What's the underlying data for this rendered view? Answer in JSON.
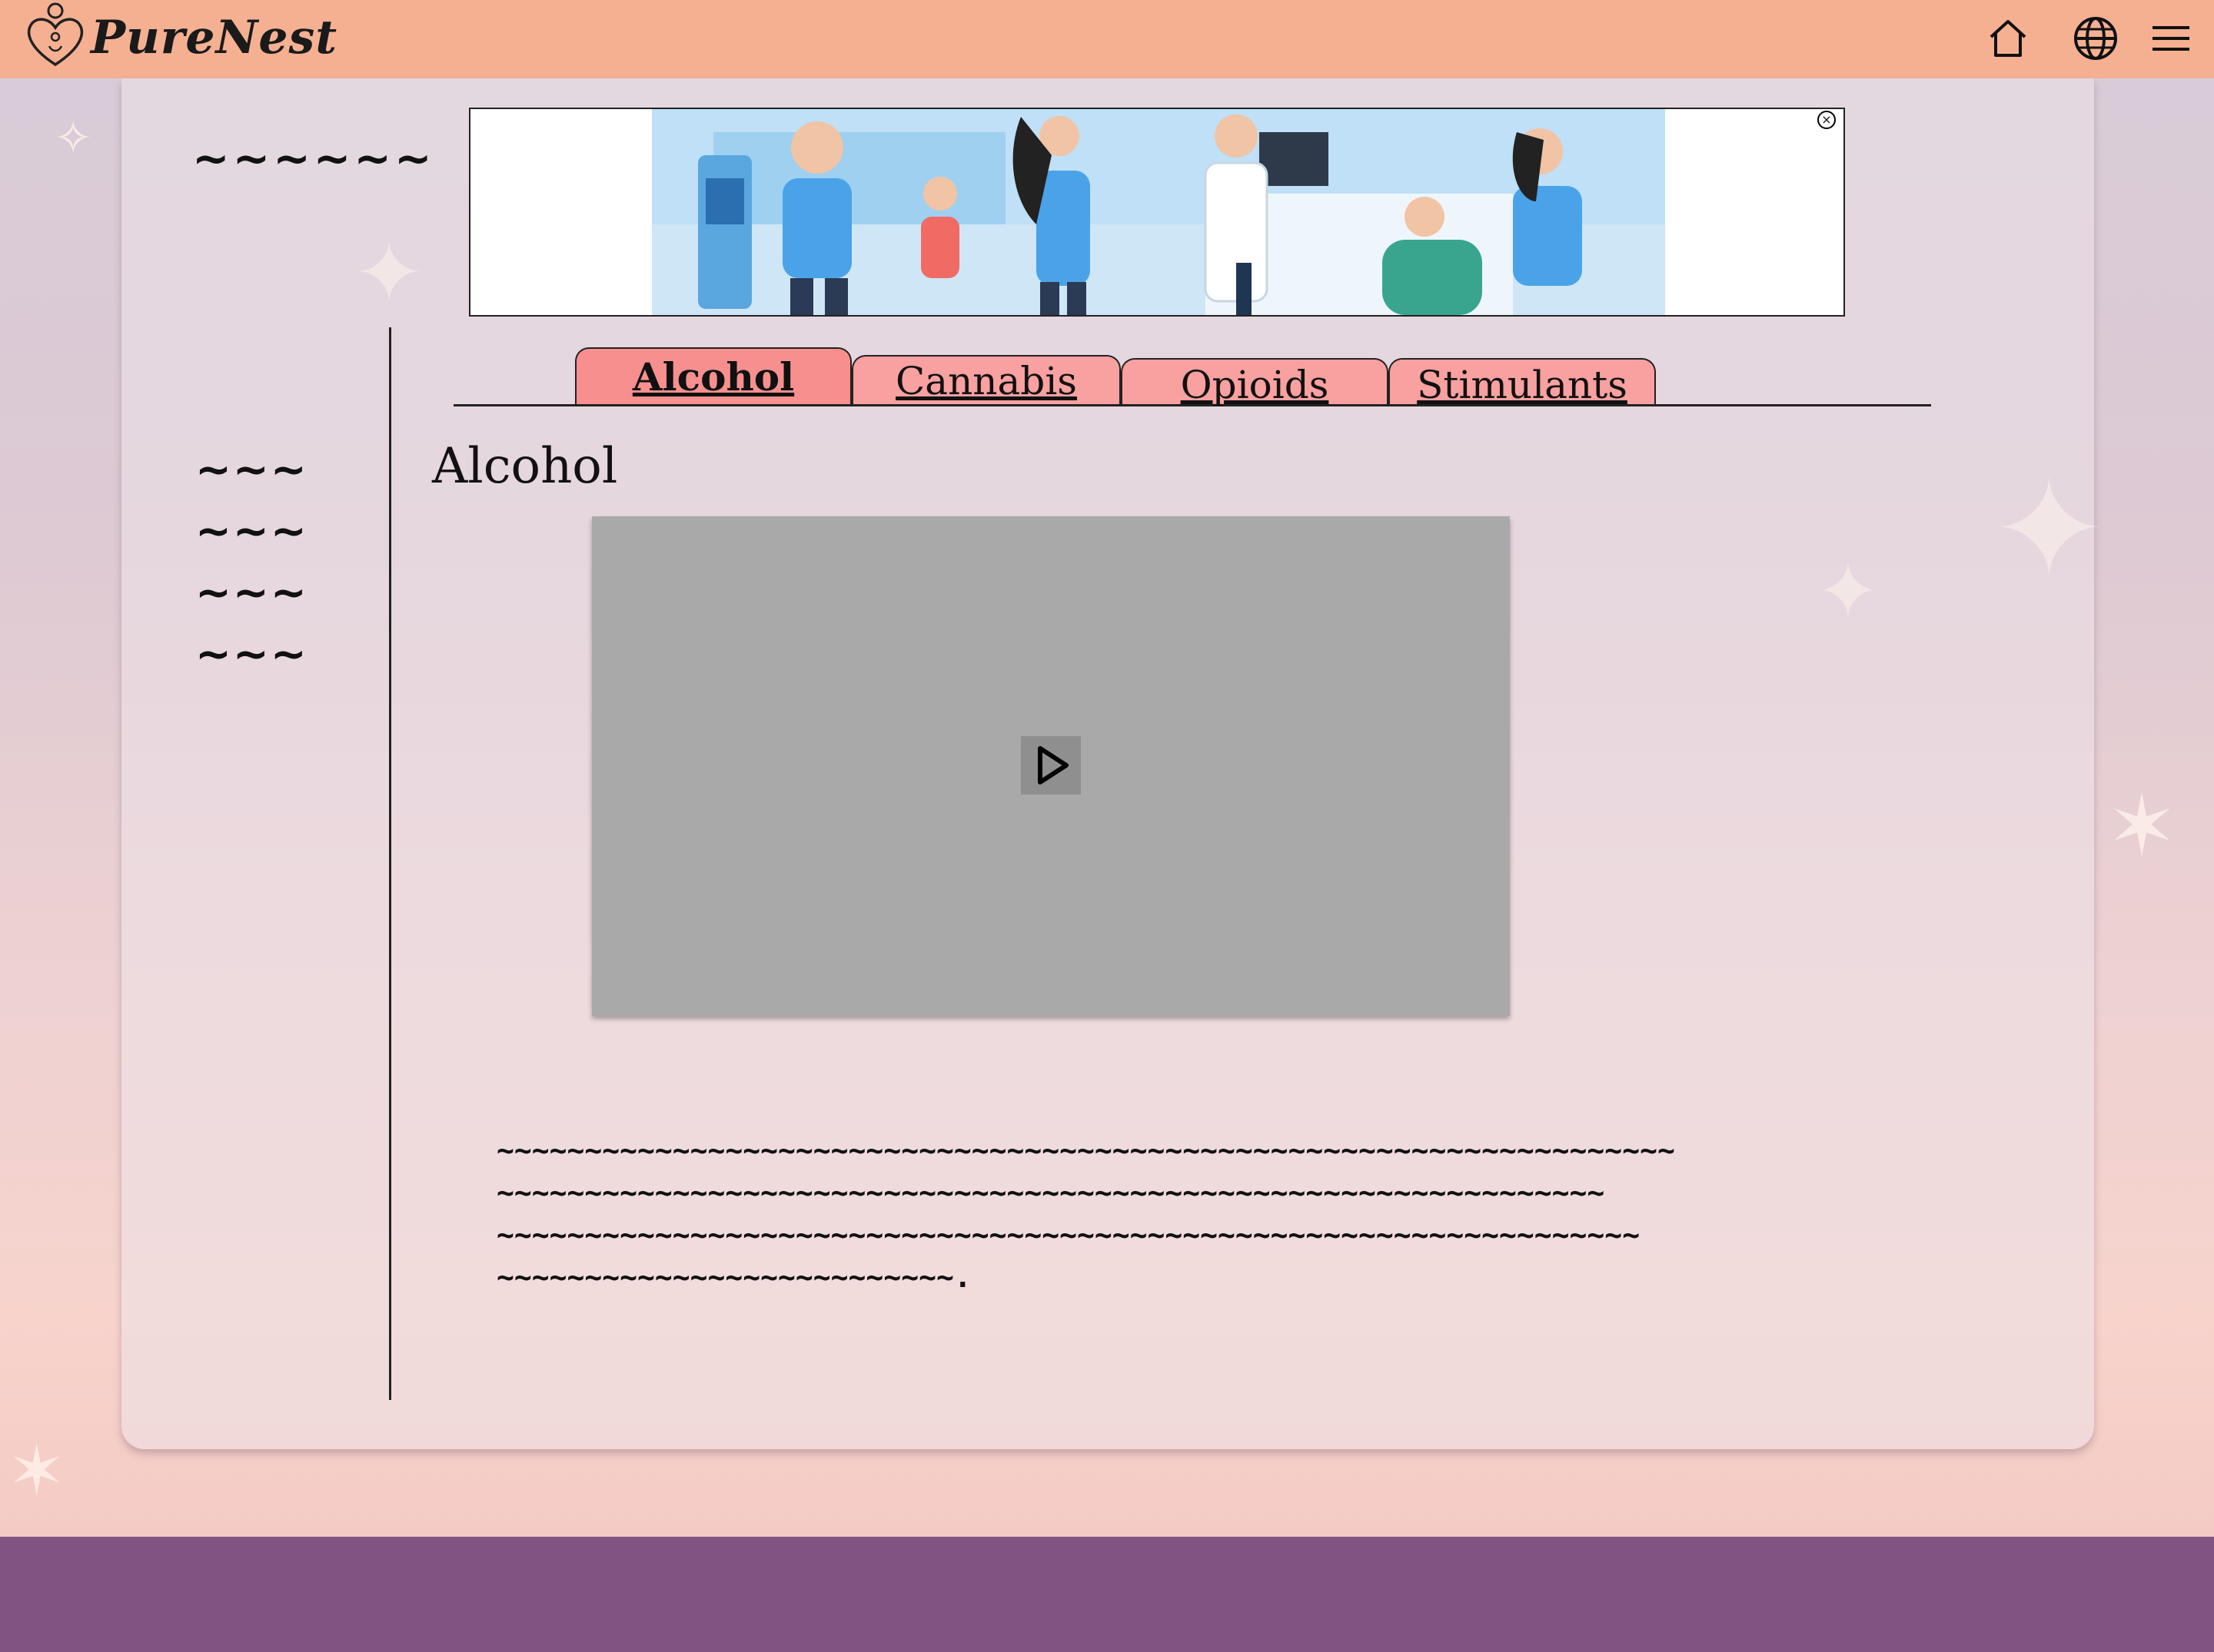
{
  "header": {
    "brand": "PureNest",
    "icons": [
      "home-icon",
      "globe-icon",
      "menu-icon"
    ]
  },
  "sidebar": {
    "title": "~~~~~~",
    "items": [
      {
        "label": "~~~"
      },
      {
        "label": "~~~"
      },
      {
        "label": "~~~"
      },
      {
        "label": "~~~"
      }
    ]
  },
  "ad": {
    "close_label": "×"
  },
  "tabs": [
    {
      "label": "Alcohol",
      "active": true
    },
    {
      "label": "Cannabis",
      "active": false
    },
    {
      "label": "Opioids",
      "active": false
    },
    {
      "label": "Stimulants",
      "active": false
    }
  ],
  "content": {
    "title": "Alcohol",
    "description": "~~~~~~~~~~~~~~~~~~~~~~~~~~~~~~~~~~~~~~~~~~~~~~~~~~~~~~~~~~~~~~~~~~~\n~~~~~~~~~~~~~~~~~~~~~~~~~~~~~~~~~~~~~~~~~~~~~~~~~~~~~~~~~~~~~~~\n~~~~~~~~~~~~~~~~~~~~~~~~~~~~~~~~~~~~~~~~~~~~~~~~~~~~~~~~~~~~~~~~~\n~~~~~~~~~~~~~~~~~~~~~~~~~~."
  },
  "colors": {
    "header": "#f5b092",
    "tab": "#f9a0a0",
    "footer": "#815383",
    "video": "#a9a9a9"
  }
}
